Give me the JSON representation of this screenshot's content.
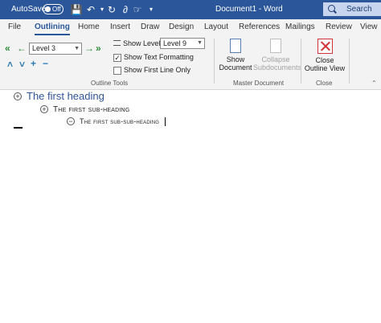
{
  "titlebar": {
    "autosave_label": "AutoSave",
    "autosave_state": "Off",
    "document_title": "Document1  -  Word",
    "search_label": "Search"
  },
  "tabs": [
    {
      "label": "File"
    },
    {
      "label": "Outlining"
    },
    {
      "label": "Home"
    },
    {
      "label": "Insert"
    },
    {
      "label": "Draw"
    },
    {
      "label": "Design"
    },
    {
      "label": "Layout"
    },
    {
      "label": "References"
    },
    {
      "label": "Mailings"
    },
    {
      "label": "Review"
    },
    {
      "label": "View"
    }
  ],
  "ribbon": {
    "outline_tools": {
      "level_value": "Level 3",
      "show_level_label": "Show Level:",
      "show_level_value": "Level 9",
      "show_text_formatting": "Show Text Formatting",
      "show_text_formatting_checked": true,
      "show_first_line_only": "Show First Line Only",
      "show_first_line_only_checked": false,
      "group_label": "Outline Tools"
    },
    "master_document": {
      "show_document_line1": "Show",
      "show_document_line2": "Document",
      "collapse_line1": "Collapse",
      "collapse_line2": "Subdocuments",
      "group_label": "Master Document"
    },
    "close": {
      "close_line1": "Close",
      "close_line2": "Outline View",
      "group_label": "Close"
    }
  },
  "document": {
    "heading1": "The first heading",
    "heading2": "The first sub-heading",
    "heading3": "The first sub-sub-heading"
  },
  "colors": {
    "title_bar": "#2b579a",
    "heading1": "#2f5597",
    "arrow_green": "#2e8b3a",
    "close_red": "#d13438"
  }
}
